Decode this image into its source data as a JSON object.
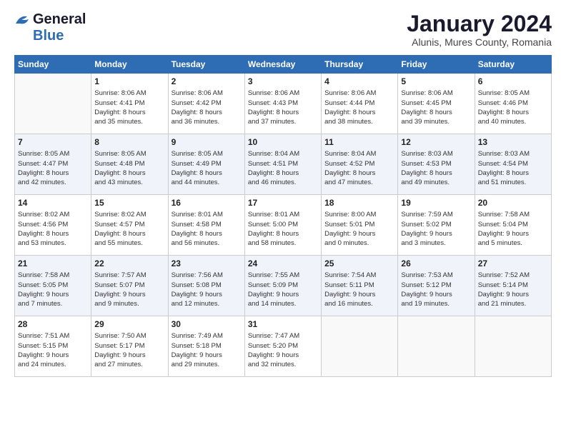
{
  "logo": {
    "line1": "General",
    "line2": "Blue"
  },
  "title": "January 2024",
  "subtitle": "Alunis, Mures County, Romania",
  "days_of_week": [
    "Sunday",
    "Monday",
    "Tuesday",
    "Wednesday",
    "Thursday",
    "Friday",
    "Saturday"
  ],
  "weeks": [
    [
      {
        "day": "",
        "info": ""
      },
      {
        "day": "1",
        "info": "Sunrise: 8:06 AM\nSunset: 4:41 PM\nDaylight: 8 hours\nand 35 minutes."
      },
      {
        "day": "2",
        "info": "Sunrise: 8:06 AM\nSunset: 4:42 PM\nDaylight: 8 hours\nand 36 minutes."
      },
      {
        "day": "3",
        "info": "Sunrise: 8:06 AM\nSunset: 4:43 PM\nDaylight: 8 hours\nand 37 minutes."
      },
      {
        "day": "4",
        "info": "Sunrise: 8:06 AM\nSunset: 4:44 PM\nDaylight: 8 hours\nand 38 minutes."
      },
      {
        "day": "5",
        "info": "Sunrise: 8:06 AM\nSunset: 4:45 PM\nDaylight: 8 hours\nand 39 minutes."
      },
      {
        "day": "6",
        "info": "Sunrise: 8:05 AM\nSunset: 4:46 PM\nDaylight: 8 hours\nand 40 minutes."
      }
    ],
    [
      {
        "day": "7",
        "info": "Sunrise: 8:05 AM\nSunset: 4:47 PM\nDaylight: 8 hours\nand 42 minutes."
      },
      {
        "day": "8",
        "info": "Sunrise: 8:05 AM\nSunset: 4:48 PM\nDaylight: 8 hours\nand 43 minutes."
      },
      {
        "day": "9",
        "info": "Sunrise: 8:05 AM\nSunset: 4:49 PM\nDaylight: 8 hours\nand 44 minutes."
      },
      {
        "day": "10",
        "info": "Sunrise: 8:04 AM\nSunset: 4:51 PM\nDaylight: 8 hours\nand 46 minutes."
      },
      {
        "day": "11",
        "info": "Sunrise: 8:04 AM\nSunset: 4:52 PM\nDaylight: 8 hours\nand 47 minutes."
      },
      {
        "day": "12",
        "info": "Sunrise: 8:03 AM\nSunset: 4:53 PM\nDaylight: 8 hours\nand 49 minutes."
      },
      {
        "day": "13",
        "info": "Sunrise: 8:03 AM\nSunset: 4:54 PM\nDaylight: 8 hours\nand 51 minutes."
      }
    ],
    [
      {
        "day": "14",
        "info": "Sunrise: 8:02 AM\nSunset: 4:56 PM\nDaylight: 8 hours\nand 53 minutes."
      },
      {
        "day": "15",
        "info": "Sunrise: 8:02 AM\nSunset: 4:57 PM\nDaylight: 8 hours\nand 55 minutes."
      },
      {
        "day": "16",
        "info": "Sunrise: 8:01 AM\nSunset: 4:58 PM\nDaylight: 8 hours\nand 56 minutes."
      },
      {
        "day": "17",
        "info": "Sunrise: 8:01 AM\nSunset: 5:00 PM\nDaylight: 8 hours\nand 58 minutes."
      },
      {
        "day": "18",
        "info": "Sunrise: 8:00 AM\nSunset: 5:01 PM\nDaylight: 9 hours\nand 0 minutes."
      },
      {
        "day": "19",
        "info": "Sunrise: 7:59 AM\nSunset: 5:02 PM\nDaylight: 9 hours\nand 3 minutes."
      },
      {
        "day": "20",
        "info": "Sunrise: 7:58 AM\nSunset: 5:04 PM\nDaylight: 9 hours\nand 5 minutes."
      }
    ],
    [
      {
        "day": "21",
        "info": "Sunrise: 7:58 AM\nSunset: 5:05 PM\nDaylight: 9 hours\nand 7 minutes."
      },
      {
        "day": "22",
        "info": "Sunrise: 7:57 AM\nSunset: 5:07 PM\nDaylight: 9 hours\nand 9 minutes."
      },
      {
        "day": "23",
        "info": "Sunrise: 7:56 AM\nSunset: 5:08 PM\nDaylight: 9 hours\nand 12 minutes."
      },
      {
        "day": "24",
        "info": "Sunrise: 7:55 AM\nSunset: 5:09 PM\nDaylight: 9 hours\nand 14 minutes."
      },
      {
        "day": "25",
        "info": "Sunrise: 7:54 AM\nSunset: 5:11 PM\nDaylight: 9 hours\nand 16 minutes."
      },
      {
        "day": "26",
        "info": "Sunrise: 7:53 AM\nSunset: 5:12 PM\nDaylight: 9 hours\nand 19 minutes."
      },
      {
        "day": "27",
        "info": "Sunrise: 7:52 AM\nSunset: 5:14 PM\nDaylight: 9 hours\nand 21 minutes."
      }
    ],
    [
      {
        "day": "28",
        "info": "Sunrise: 7:51 AM\nSunset: 5:15 PM\nDaylight: 9 hours\nand 24 minutes."
      },
      {
        "day": "29",
        "info": "Sunrise: 7:50 AM\nSunset: 5:17 PM\nDaylight: 9 hours\nand 27 minutes."
      },
      {
        "day": "30",
        "info": "Sunrise: 7:49 AM\nSunset: 5:18 PM\nDaylight: 9 hours\nand 29 minutes."
      },
      {
        "day": "31",
        "info": "Sunrise: 7:47 AM\nSunset: 5:20 PM\nDaylight: 9 hours\nand 32 minutes."
      },
      {
        "day": "",
        "info": ""
      },
      {
        "day": "",
        "info": ""
      },
      {
        "day": "",
        "info": ""
      }
    ]
  ]
}
